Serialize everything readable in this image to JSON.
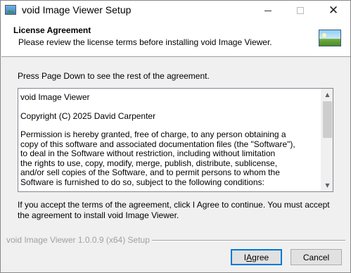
{
  "window": {
    "title": "void Image Viewer Setup",
    "controls": {
      "minimize": "minimize",
      "maximize": "maximize",
      "close": "✕"
    }
  },
  "header": {
    "title": "License Agreement",
    "subtitle": "Please review the license terms before installing void Image Viewer.",
    "image_icon": "installer-image-icon"
  },
  "instruction": "Press Page Down to see the rest of the agreement.",
  "license": {
    "paragraphs": [
      "void Image Viewer",
      "Copyright (C) 2025 David Carpenter",
      "Permission is hereby granted, free of charge, to any person obtaining a\ncopy of this software and associated documentation files (the \"Software\"),\nto deal in the Software without restriction, including without limitation\nthe rights to use, copy, modify, merge, publish, distribute, sublicense,\nand/or sell copies of the Software, and to permit persons to whom the\nSoftware is furnished to do so, subject to the following conditions:"
    ]
  },
  "accept_text": "If you accept the terms of the agreement, click I Agree to continue. You must accept the agreement to install void Image Viewer.",
  "footer": {
    "brand": "void Image Viewer 1.0.0.9 (x64) Setup"
  },
  "buttons": {
    "agree_prefix": "I ",
    "agree_underlined": "A",
    "agree_suffix": "gree",
    "cancel": "Cancel"
  },
  "colors": {
    "focus_border": "#0078d7",
    "dialog_bg": "#f0f0f0"
  }
}
